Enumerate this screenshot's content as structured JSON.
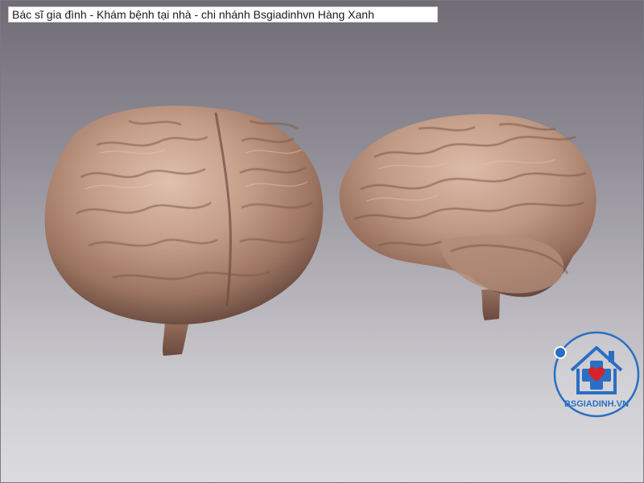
{
  "caption": "Bác sĩ gia đình - Khám bệnh tại nhà - chi nhánh Bsgiadinhvn Hàng Xanh",
  "logo": {
    "text": "BSGIADINH.VN",
    "ring_color": "#2a6fc4",
    "heart_color": "#d8222a"
  },
  "brain_color": "#c29a86"
}
